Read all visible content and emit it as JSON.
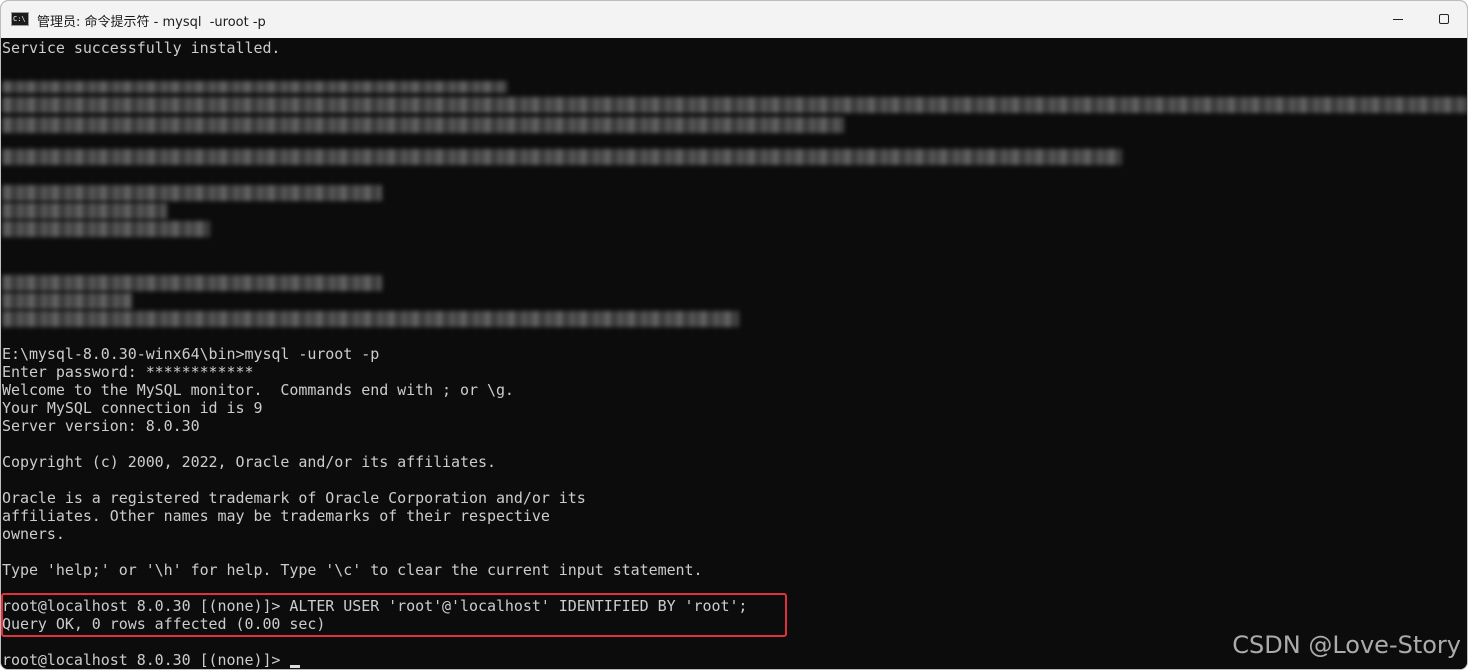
{
  "window": {
    "title": "管理员: 命令提示符 - mysql  -uroot -p",
    "icon": "cmd-icon"
  },
  "console": {
    "line_service": "Service successfully installed.",
    "line_cmd": "E:\\mysql-8.0.30-winx64\\bin>mysql -uroot -p",
    "line_password": "Enter password: ************",
    "line_welcome": "Welcome to the MySQL monitor.  Commands end with ; or \\g.",
    "line_connid": "Your MySQL connection id is 9",
    "line_version": "Server version: 8.0.30",
    "line_copyright": "Copyright (c) 2000, 2022, Oracle and/or its affiliates.",
    "line_oracle1": "Oracle is a registered trademark of Oracle Corporation and/or its",
    "line_oracle2": "affiliates. Other names may be trademarks of their respective",
    "line_oracle3": "owners.",
    "line_help": "Type 'help;' or '\\h' for help. Type '\\c' to clear the current input statement.",
    "line_alter": "root@localhost 8.0.30 [(none)]> ALTER USER 'root'@'localhost' IDENTIFIED BY 'root';",
    "line_queryok": "Query OK, 0 rows affected (0.00 sec)",
    "line_prompt": "root@localhost 8.0.30 [(none)]> "
  },
  "watermark": "CSDN @Love-Story",
  "colors": {
    "console_bg": "#0c0c0c",
    "console_text": "#cccccc",
    "highlight": "#e0303c"
  }
}
